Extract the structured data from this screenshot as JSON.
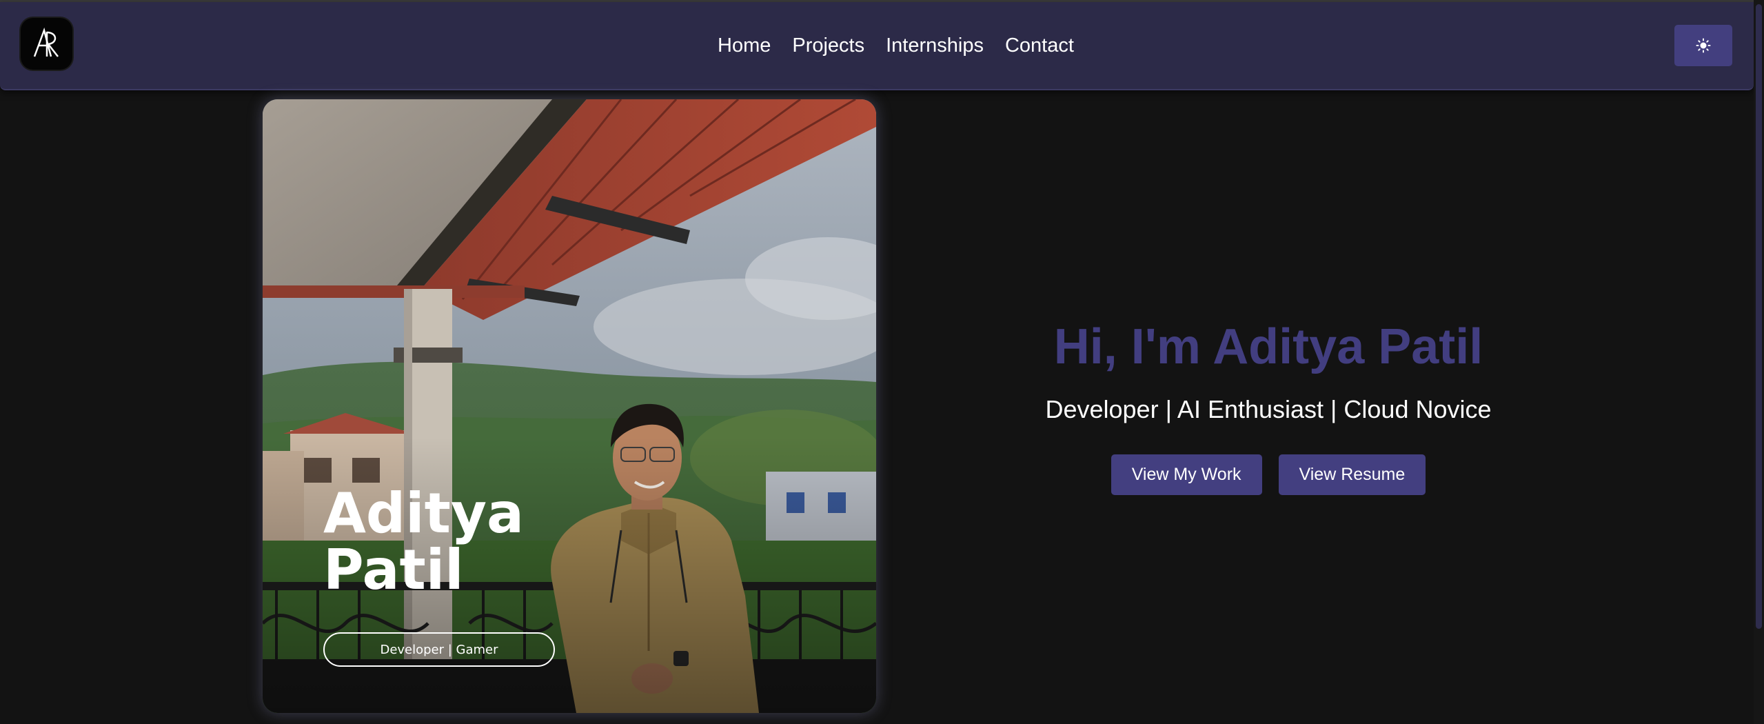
{
  "header": {
    "logo_text": "AP",
    "nav": [
      {
        "label": "Home"
      },
      {
        "label": "Projects"
      },
      {
        "label": "Internships"
      },
      {
        "label": "Contact"
      }
    ],
    "theme_toggle_icon": "sun-icon"
  },
  "profile_card": {
    "name_first": "Aditya",
    "name_last": "Patil",
    "tag": "Developer | Gamer"
  },
  "hero": {
    "title": "Hi, I'm Aditya Patil",
    "subtitle": "Developer | AI Enthusiast | Cloud Novice",
    "buttons": {
      "primary": "View My Work",
      "secondary": "View Resume"
    }
  },
  "colors": {
    "background": "#131313",
    "navbar": "#2c2a48",
    "accent": "#433f80",
    "title": "#423e80",
    "text": "#ffffff"
  }
}
